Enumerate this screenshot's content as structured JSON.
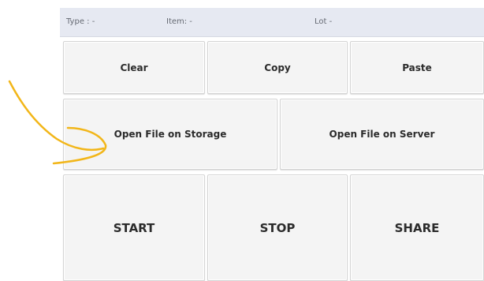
{
  "info_bar": {
    "type": "Type : -",
    "item": "Item: -",
    "lot": "Lot -"
  },
  "buttons": {
    "clear": "Clear",
    "copy": "Copy",
    "paste": "Paste",
    "open_storage": "Open File on Storage",
    "open_server": "Open File on Server",
    "start": "START",
    "stop": "STOP",
    "share": "SHARE"
  },
  "colors": {
    "info_bar_bg": "#e6e9f2",
    "button_bg": "#f4f4f4",
    "annotation_stroke": "#f2b619"
  },
  "annotation": {
    "kind": "hand-drawn-arrow-icon"
  }
}
